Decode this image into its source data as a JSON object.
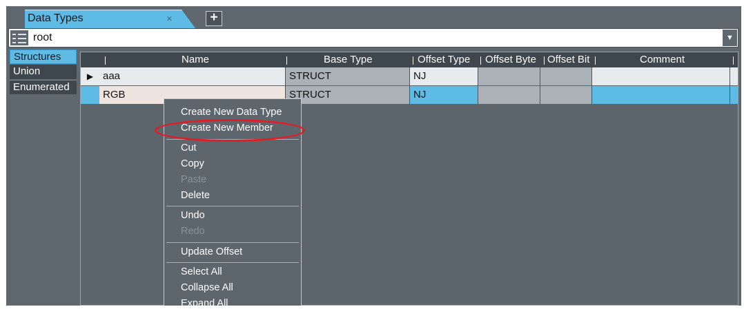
{
  "tab": {
    "title": "Data Types",
    "close_glyph": "×",
    "add_glyph": "+"
  },
  "root": {
    "value": "root",
    "dropdown_glyph": "▼"
  },
  "categories": [
    "Structures",
    "Union",
    "Enumerated"
  ],
  "grid": {
    "columns": [
      "Name",
      "Base Type",
      "Offset Type",
      "Offset Byte",
      "Offset Bit",
      "Comment"
    ],
    "rows": [
      {
        "marker": "▶",
        "name": "aaa",
        "base_type": "STRUCT",
        "offset_type": "NJ"
      },
      {
        "marker": "",
        "name": "RGB",
        "base_type": "STRUCT",
        "offset_type": "NJ"
      }
    ]
  },
  "context_menu": {
    "create_new_data_type": "Create New Data Type",
    "create_new_member": "Create New Member",
    "cut": "Cut",
    "copy": "Copy",
    "paste": "Paste",
    "delete": "Delete",
    "undo": "Undo",
    "redo": "Redo",
    "update_offset": "Update Offset",
    "select_all": "Select All",
    "collapse_all": "Collapse All",
    "expand_all": "Expand All"
  },
  "colors": {
    "accent": "#5ebbe6",
    "highlight_ring": "#e21d25",
    "panel": "#5f676f"
  }
}
